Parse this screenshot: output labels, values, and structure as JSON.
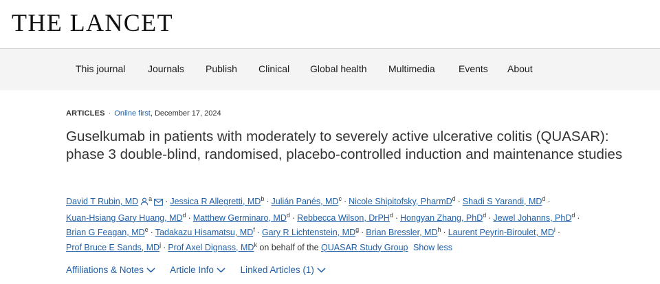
{
  "site": {
    "logo": "THE LANCET"
  },
  "nav": {
    "items": [
      "This journal",
      "Journals",
      "Publish",
      "Clinical",
      "Global health",
      "Multimedia",
      "Events",
      "About"
    ]
  },
  "article": {
    "type": "ARTICLES",
    "status": "Online first",
    "date": ", December 17, 2024",
    "title": "Guselkumab in patients with moderately to severely active ulcerative colitis (QUASAR): phase 3 double-blind, randomised, placebo-controlled induction and maintenance studies",
    "authors": [
      {
        "name": "David T Rubin, MD",
        "sup": "a"
      },
      {
        "name": "Jessica R Allegretti, MD",
        "sup": "b"
      },
      {
        "name": "Julián Panés, MD",
        "sup": "c"
      },
      {
        "name": "Nicole Shipitofsky, PharmD",
        "sup": "d"
      },
      {
        "name": "Shadi S Yarandi, MD",
        "sup": "d"
      },
      {
        "name": "Kuan-Hsiang Gary Huang, MD",
        "sup": "d"
      },
      {
        "name": "Matthew Germinaro, MD",
        "sup": "d"
      },
      {
        "name": "Rebbecca Wilson, DrPH",
        "sup": "d"
      },
      {
        "name": "Hongyan Zhang, PhD",
        "sup": "d"
      },
      {
        "name": "Jewel Johanns, PhD",
        "sup": "d"
      },
      {
        "name": "Brian G Feagan, MD",
        "sup": "e"
      },
      {
        "name": "Tadakazu Hisamatsu, MD",
        "sup": "f"
      },
      {
        "name": "Gary R Lichtenstein, MD",
        "sup": "g"
      },
      {
        "name": "Brian Bressler, MD",
        "sup": "h"
      },
      {
        "name": "Laurent Peyrin-Biroulet, MD",
        "sup": "i"
      },
      {
        "name": "Prof Bruce E Sands, MD",
        "sup": "j"
      },
      {
        "name": "Prof Axel Dignass, MD",
        "sup": "k"
      }
    ],
    "on_behalf": "on behalf of the",
    "study_group": "QUASAR Study Group",
    "show_less": "Show less"
  },
  "tabs": [
    "Affiliations & Notes",
    "Article Info",
    "Linked Articles (1)"
  ],
  "colors": {
    "link": "#1f5fa8",
    "nav_bg": "#f4f4f4"
  }
}
